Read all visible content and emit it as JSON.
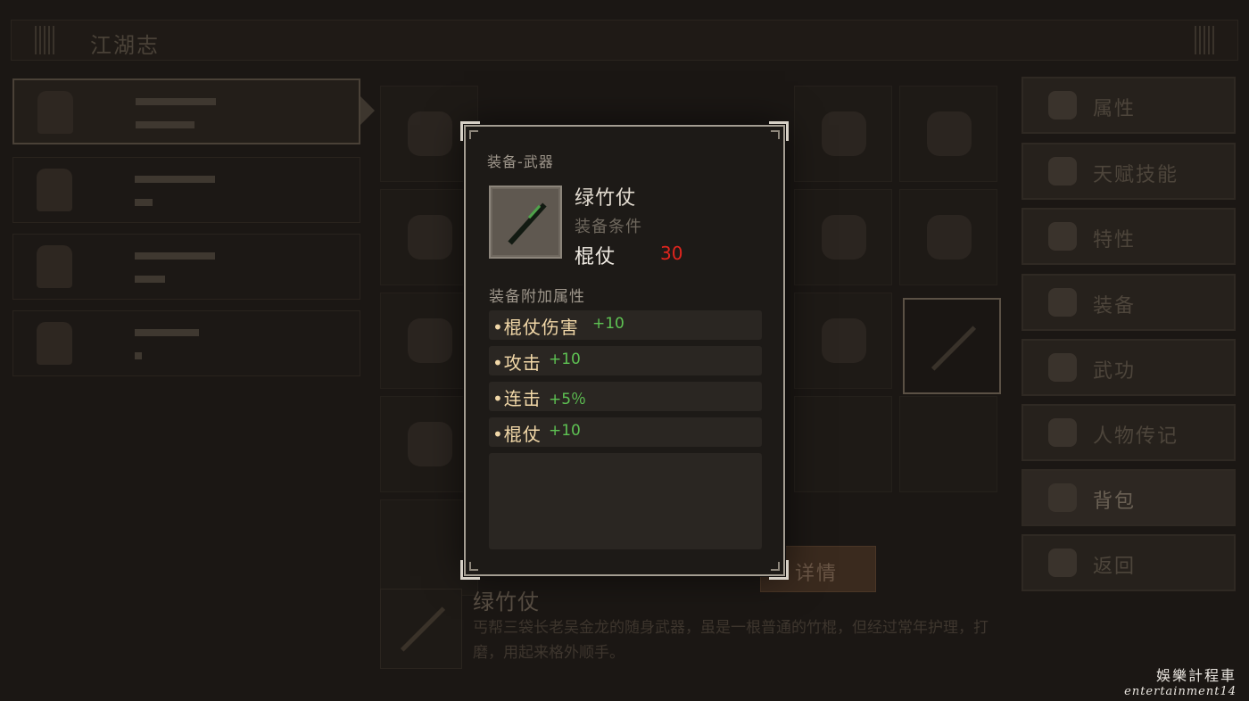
{
  "background": {
    "title": "江湖志",
    "side_menu": [
      {
        "label": "属性",
        "icon": "person-icon"
      },
      {
        "label": "天赋技能",
        "icon": "person-halo-icon"
      },
      {
        "label": "特性",
        "icon": "person-icon"
      },
      {
        "label": "装备",
        "icon": "sword-icon"
      },
      {
        "label": "武功",
        "icon": "scroll-icon"
      },
      {
        "label": "人物传记",
        "icon": "book-icon"
      },
      {
        "label": "背包",
        "icon": "bag-icon"
      },
      {
        "label": "返回",
        "icon": "door-icon"
      }
    ],
    "active_menu": "背包",
    "detail_button": "详情",
    "item_name": "绿竹仗",
    "item_description": "丐帮三袋长老吴金龙的随身武器，虽是一根普通的竹棍，但经过常年护理，打磨，用起来格外顺手。"
  },
  "modal": {
    "category": "装备-武器",
    "item_name": "绿竹仗",
    "requirement_label": "装备条件",
    "requirement_type": "棍仗",
    "requirement_value": "30",
    "bonus_section_label": "装备附加属性",
    "bonuses": [
      {
        "name": "•棍仗伤害",
        "value": "+10"
      },
      {
        "name": "•攻击",
        "value": "+10"
      },
      {
        "name": "•连击",
        "value": "+5％"
      },
      {
        "name": "•棍仗",
        "value": "+10"
      }
    ]
  },
  "watermark": {
    "line1": "娛樂計程車",
    "line2": "entertainment14"
  },
  "colors": {
    "requirement_value": "#e0251e",
    "bonus_value": "#5ec253",
    "bonus_name": "#f2d8a8"
  }
}
